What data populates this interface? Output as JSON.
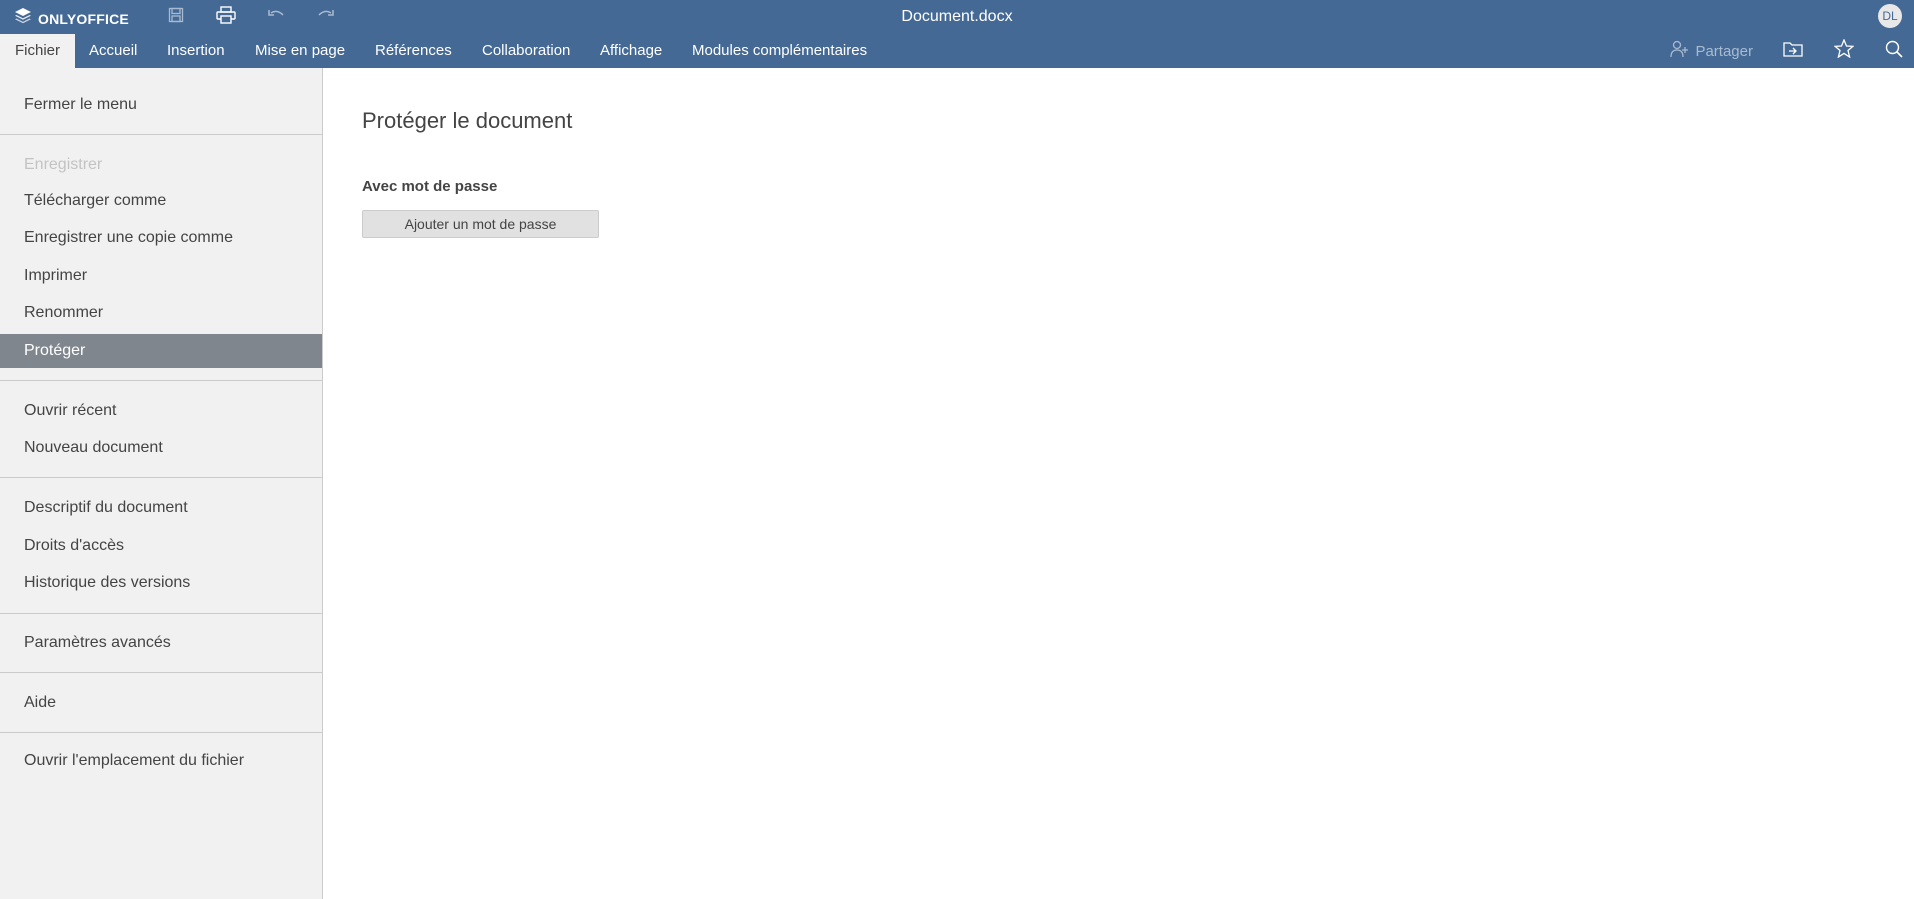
{
  "app": {
    "logo_text": "ONLYOFFICE",
    "document_title": "Document.docx",
    "user_initials": "DL"
  },
  "quick_access": [
    {
      "icon": "save-icon"
    },
    {
      "icon": "print-icon"
    },
    {
      "icon": "undo-icon"
    },
    {
      "icon": "redo-icon"
    }
  ],
  "tabs": [
    {
      "label": "Fichier",
      "active": true
    },
    {
      "label": "Accueil"
    },
    {
      "label": "Insertion"
    },
    {
      "label": "Mise en page"
    },
    {
      "label": "Références"
    },
    {
      "label": "Collaboration"
    },
    {
      "label": "Affichage"
    },
    {
      "label": "Modules complémentaires"
    }
  ],
  "right_tools": {
    "share_label": "Partager",
    "icons": [
      "share-user-icon",
      "open-location-icon",
      "star-icon",
      "search-icon"
    ]
  },
  "file_menu": {
    "items": [
      {
        "label": "Fermer le menu"
      },
      {
        "label": "Enregistrer",
        "disabled": true
      },
      {
        "label": "Télécharger comme"
      },
      {
        "label": "Enregistrer une copie comme"
      },
      {
        "label": "Imprimer"
      },
      {
        "label": "Renommer"
      },
      {
        "label": "Protéger",
        "active": true
      },
      {
        "label": "Ouvrir récent"
      },
      {
        "label": "Nouveau document"
      },
      {
        "label": "Descriptif du document"
      },
      {
        "label": "Droits d'accès"
      },
      {
        "label": "Historique des versions"
      },
      {
        "label": "Paramètres avancés"
      },
      {
        "label": "Aide"
      },
      {
        "label": "Ouvrir l'emplacement du fichier"
      }
    ]
  },
  "protect_panel": {
    "title": "Protéger le document",
    "section_label": "Avec mot de passe",
    "add_password_button": "Ajouter un mot de passe"
  },
  "colors": {
    "header_bg": "#446995",
    "sidebar_bg": "#f1f1f1",
    "active_item_bg": "#7f868e",
    "disabled_text": "#c3c3c3"
  }
}
